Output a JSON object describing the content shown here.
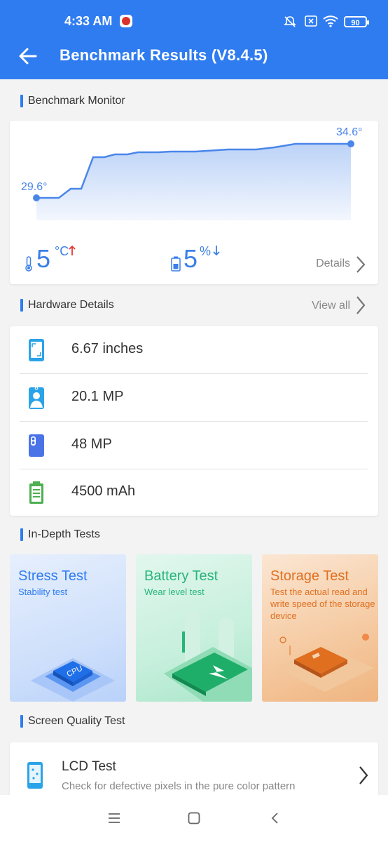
{
  "status_bar": {
    "time": "4:33 AM",
    "battery": "90"
  },
  "header": {
    "title": "Benchmark Results (V8.4.5)"
  },
  "monitor": {
    "section_title": "Benchmark Monitor",
    "start_temp": "29.6°",
    "end_temp": "34.6°",
    "temp_rise_value": "5",
    "temp_rise_unit": "°C",
    "battery_drop_value": "5",
    "battery_drop_unit": "%",
    "details_label": "Details"
  },
  "hardware": {
    "section_title": "Hardware Details",
    "view_all_label": "View all",
    "items": [
      {
        "icon": "screen-icon",
        "value": "6.67 inches"
      },
      {
        "icon": "front-camera-icon",
        "value": "20.1 MP"
      },
      {
        "icon": "rear-camera-icon",
        "value": "48 MP"
      },
      {
        "icon": "battery-icon",
        "value": "4500 mAh"
      }
    ]
  },
  "in_depth": {
    "section_title": "In-Depth Tests",
    "cards": [
      {
        "title": "Stress Test",
        "subtitle": "Stability test",
        "chip_label": "CPU",
        "accent": "#2f7cf0"
      },
      {
        "title": "Battery Test",
        "subtitle": "Wear level test",
        "accent": "#27b57a"
      },
      {
        "title": "Storage Test",
        "subtitle": "Test the actual read and write speed of the storage device",
        "accent": "#e07020"
      }
    ]
  },
  "screen_quality": {
    "section_title": "Screen Quality Test",
    "lcd_title": "LCD Test",
    "lcd_subtitle": "Check for defective pixels in the pure color pattern"
  },
  "colors": {
    "primary": "#2f7cf0",
    "text": "#333333",
    "muted": "#888888",
    "warning": "#e53935"
  }
}
